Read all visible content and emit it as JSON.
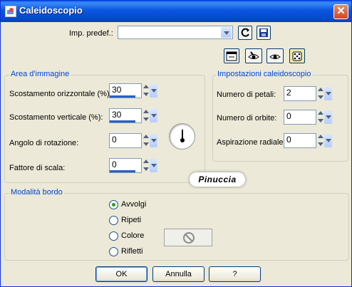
{
  "window": {
    "title": "Caleidoscopio"
  },
  "preset": {
    "label": "Imp. predef.:",
    "value": ""
  },
  "image_area": {
    "title": "Area d'immagine",
    "fields": [
      {
        "label": "Scostamento orizzontale (%):",
        "value": "30",
        "fill": 0.8
      },
      {
        "label": "Scostamento verticale (%):",
        "value": "30",
        "fill": 0.8
      },
      {
        "label": "Angolo di rotazione:",
        "value": "0",
        "fill": 0
      },
      {
        "label": "Fattore di scala:",
        "value": "0",
        "fill": 0.8
      }
    ]
  },
  "kaleidoscope_settings": {
    "title": "Impostazioni caleidoscopio",
    "fields": [
      {
        "label": "Numero di petali:",
        "value": "2"
      },
      {
        "label": "Numero di orbite:",
        "value": "0"
      },
      {
        "label": "Aspirazione radiale:",
        "value": "0"
      }
    ]
  },
  "watermark": "Pinuccia",
  "edge_mode": {
    "title": "Modalità bordo",
    "options": [
      "Avvolgi",
      "Ripeti",
      "Colore",
      "Rifletti"
    ],
    "selected": "Avvolgi"
  },
  "buttons": {
    "ok": "OK",
    "cancel": "Annulla",
    "help": "?"
  },
  "icons": [
    "app-icon",
    "close-icon",
    "reset-preset-icon",
    "save-preset-icon",
    "window-preview-icon",
    "proof-icon",
    "eye-icon",
    "randomize-icon",
    "no-color-icon"
  ],
  "colors": {
    "titlebar": "#0a5fe8",
    "group_title": "#0046d5",
    "close": "#d2471f",
    "face": "#ece9d8"
  }
}
